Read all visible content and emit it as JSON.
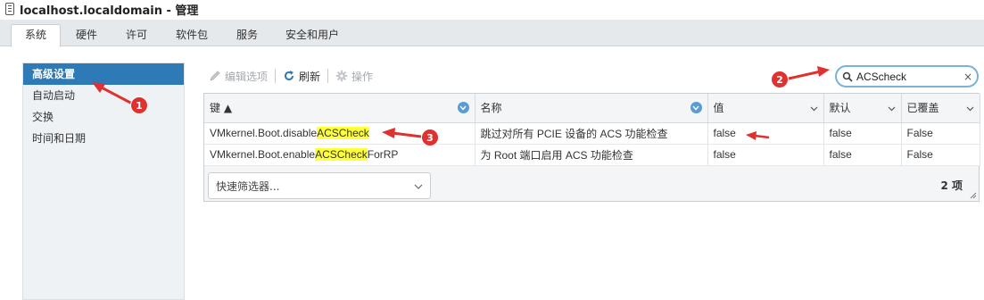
{
  "window": {
    "title": "localhost.localdomain - 管理"
  },
  "tabs": [
    {
      "label": "系统"
    },
    {
      "label": "硬件"
    },
    {
      "label": "许可"
    },
    {
      "label": "软件包"
    },
    {
      "label": "服务"
    },
    {
      "label": "安全和用户"
    }
  ],
  "sidebar": {
    "items": [
      {
        "label": "高级设置"
      },
      {
        "label": "自动启动"
      },
      {
        "label": "交换"
      },
      {
        "label": "时间和日期"
      }
    ]
  },
  "toolbar": {
    "edit_label": "编辑选项",
    "refresh_label": "刷新",
    "actions_label": "操作"
  },
  "search": {
    "value": "ACScheck",
    "clear_glyph": "×"
  },
  "grid": {
    "columns": [
      {
        "label": "键 ▲"
      },
      {
        "label": "名称"
      },
      {
        "label": "值"
      },
      {
        "label": "默认"
      },
      {
        "label": "已覆盖"
      }
    ],
    "rows": [
      {
        "key_prefix": "VMkernel.Boot.disable",
        "key_highlight": "ACSCheck",
        "key_suffix": "",
        "name": "跳过对所有 PCIE 设备的 ACS 功能检查",
        "value": "false",
        "default": "false",
        "overridden": "False"
      },
      {
        "key_prefix": "VMkernel.Boot.enable",
        "key_highlight": "ACSCheck",
        "key_suffix": "ForRP",
        "name": "为 Root 端口启用 ACS 功能检查",
        "value": "false",
        "default": "false",
        "overridden": "False"
      }
    ],
    "quick_filter_placeholder": "快速筛选器...",
    "item_count": "2 项"
  },
  "annotations": {
    "badge1": "1",
    "badge2": "2",
    "badge3": "3"
  },
  "colors": {
    "accent": "#2d7ab6",
    "highlight": "#ffff3a",
    "annotation": "#e03131"
  }
}
